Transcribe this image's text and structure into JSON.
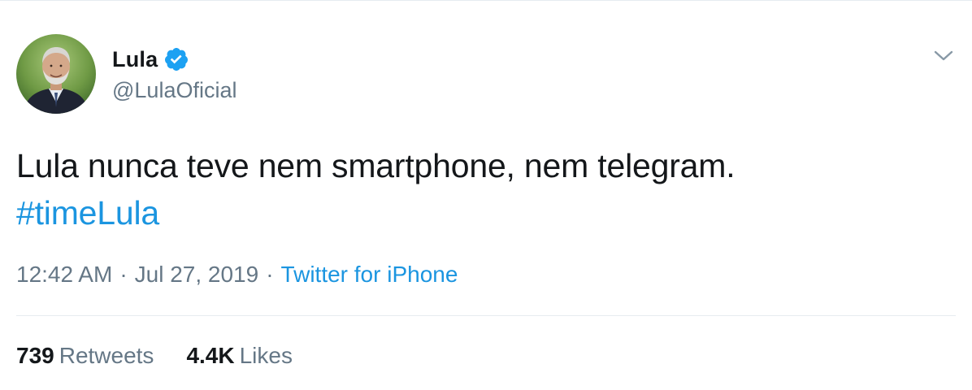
{
  "author": {
    "display_name": "Lula",
    "handle": "@LulaOficial",
    "verified": true,
    "avatar_icon": "profile-photo"
  },
  "tweet": {
    "text": "Lula nunca teve nem smartphone, nem telegram.",
    "hashtag": "#timeLula"
  },
  "meta": {
    "time": "12:42 AM",
    "separator": "·",
    "date": "Jul 27, 2019",
    "source": "Twitter for iPhone"
  },
  "stats": {
    "retweets_count": "739",
    "retweets_label": "Retweets",
    "likes_count": "4.4K",
    "likes_label": "Likes"
  },
  "colors": {
    "link_blue": "#1b95e0",
    "verified_blue": "#1da1f2",
    "muted_gray": "#657786",
    "text_dark": "#14171a",
    "divider": "#e6ecf0"
  },
  "icons": {
    "verified": "verified-badge-icon",
    "menu": "chevron-down-icon"
  }
}
